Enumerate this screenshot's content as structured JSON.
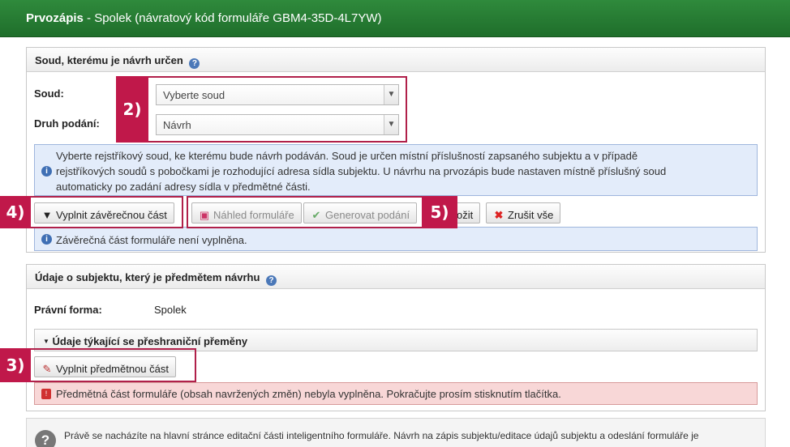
{
  "header": {
    "title_bold": "Prvozápis",
    "title_rest": " - Spolek (návratový kód formuláře GBM4-35D-4L7YW)"
  },
  "court_panel": {
    "title": "Soud, kterému je návrh určen",
    "court_label": "Soud:",
    "court_value": "Vyberte soud",
    "type_label": "Druh podání:",
    "type_value": "Návrh",
    "info_text_1": "Vyberte rejstříkový soud, ke kterému bude návrh podáván. Soud je určen místní příslušností zapsaného subjektu a v případě",
    "info_text_2": "rejstříkových soudů s pobočkami je rozhodující adresa sídla subjektu. U návrhu na prvozápis bude nastaven místně příslušný soud",
    "info_text_3": "automaticky po zadání adresy sídla v předmětné části.",
    "buttons": {
      "fill_final": "Vyplnit závěrečnou část",
      "preview": "Náhled formuláře",
      "generate": "Generovat podání",
      "save_partial": "ožit",
      "cancel_all": "Zrušit vše"
    },
    "final_status": "Závěrečná část formuláře není vyplněna."
  },
  "subject_panel": {
    "title": "Údaje o subjektu, který je předmětem návrhu",
    "legal_form_label": "Právní forma:",
    "legal_form_value": "Spolek",
    "cross_border_title": "Údaje týkající se přeshraniční přeměny",
    "fill_subject_button": "Vyplnit předmětnou část",
    "error_text": "Předmětná část formuláře (obsah navržených změn) nebyla vyplněna. Pokračujte prosím stisknutím tlačítka."
  },
  "bottom_hint": "Právě se nacházíte na hlavní stránce editační části inteligentního formuláře. Návrh na zápis subjektu/editace údajů subjektu a odeslání formuláře je",
  "badges": {
    "b2": "2)",
    "b3": "3)",
    "b4": "4)",
    "b5": "5)"
  },
  "icons": {
    "help": "?",
    "info": "i",
    "error": "!",
    "question": "?"
  },
  "colors": {
    "header_green": "#2f8a3c",
    "badge_red": "#c0184a",
    "info_blue": "#e3ecfa",
    "error_red": "#f8d7d7"
  }
}
